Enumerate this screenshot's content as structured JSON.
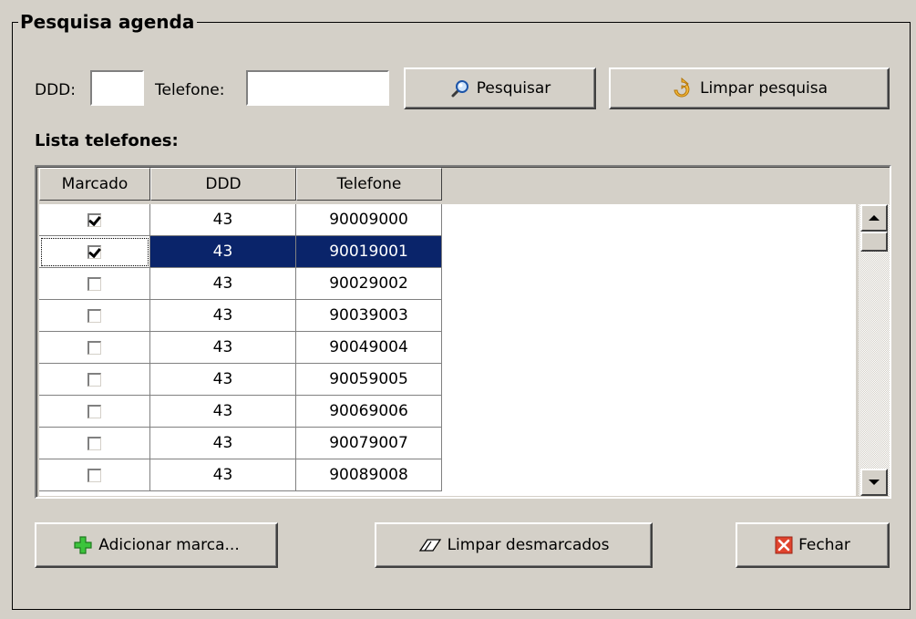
{
  "group": {
    "title": "Pesquisa agenda"
  },
  "search": {
    "ddd_label": "DDD:",
    "ddd_value": "",
    "telefone_label": "Telefone:",
    "telefone_value": "",
    "pesquisar_label": "Pesquisar",
    "limpar_pesquisa_label": "Limpar pesquisa"
  },
  "list": {
    "title": "Lista telefones:",
    "columns": [
      "Marcado",
      "DDD",
      "Telefone"
    ],
    "rows": [
      {
        "checked": true,
        "ddd": "43",
        "telefone": "90009000",
        "selected": false
      },
      {
        "checked": true,
        "ddd": "43",
        "telefone": "90019001",
        "selected": true
      },
      {
        "checked": false,
        "ddd": "43",
        "telefone": "90029002",
        "selected": false
      },
      {
        "checked": false,
        "ddd": "43",
        "telefone": "90039003",
        "selected": false
      },
      {
        "checked": false,
        "ddd": "43",
        "telefone": "90049004",
        "selected": false
      },
      {
        "checked": false,
        "ddd": "43",
        "telefone": "90059005",
        "selected": false
      },
      {
        "checked": false,
        "ddd": "43",
        "telefone": "90069006",
        "selected": false
      },
      {
        "checked": false,
        "ddd": "43",
        "telefone": "90079007",
        "selected": false
      },
      {
        "checked": false,
        "ddd": "43",
        "telefone": "90089008",
        "selected": false
      }
    ]
  },
  "actions": {
    "adicionar_label": "Adicionar marca...",
    "limpar_desmarcados_label": "Limpar desmarcados",
    "fechar_label": "Fechar"
  },
  "icons": {
    "pesquisar": "magnifier-icon",
    "limpar_pesquisa": "refresh-arrow-icon",
    "adicionar": "plus-icon",
    "limpar_desmarcados": "eraser-icon",
    "fechar": "close-x-icon"
  },
  "colors": {
    "selection": "#0a246a",
    "window": "#d4d0c8",
    "plus_green": "#2ea82e",
    "close_red": "#d83a2a"
  }
}
